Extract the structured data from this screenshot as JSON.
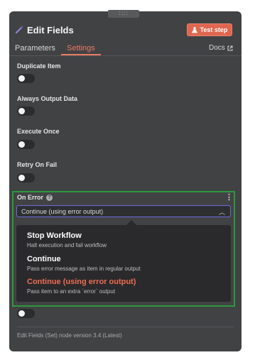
{
  "header": {
    "title": "Edit Fields",
    "test_step_label": "Test step"
  },
  "tabs": [
    {
      "label": "Parameters",
      "active": false
    },
    {
      "label": "Settings",
      "active": true
    }
  ],
  "docs_label": "Docs",
  "settings": [
    {
      "label": "Duplicate Item",
      "enabled": false
    },
    {
      "label": "Always Output Data",
      "enabled": false
    },
    {
      "label": "Execute Once",
      "enabled": false
    },
    {
      "label": "Retry On Fail",
      "enabled": false
    }
  ],
  "on_error": {
    "label": "On Error",
    "selected_value": "Continue (using error output)",
    "options": [
      {
        "title": "Stop Workflow",
        "description": "Halt execution and fail workflow",
        "selected": false
      },
      {
        "title": "Continue",
        "description": "Pass error message as item in regular output",
        "selected": false
      },
      {
        "title": "Continue (using error output)",
        "description": "Pass item to an extra `error` output",
        "selected": true
      }
    ]
  },
  "footer_text": "Edit Fields (Set) node version 3.4 (Latest)",
  "colors": {
    "panel_bg": "#414244",
    "accent": "#ea7a63",
    "highlight_box": "#2a9a3c",
    "select_border": "#6c6ce0"
  }
}
